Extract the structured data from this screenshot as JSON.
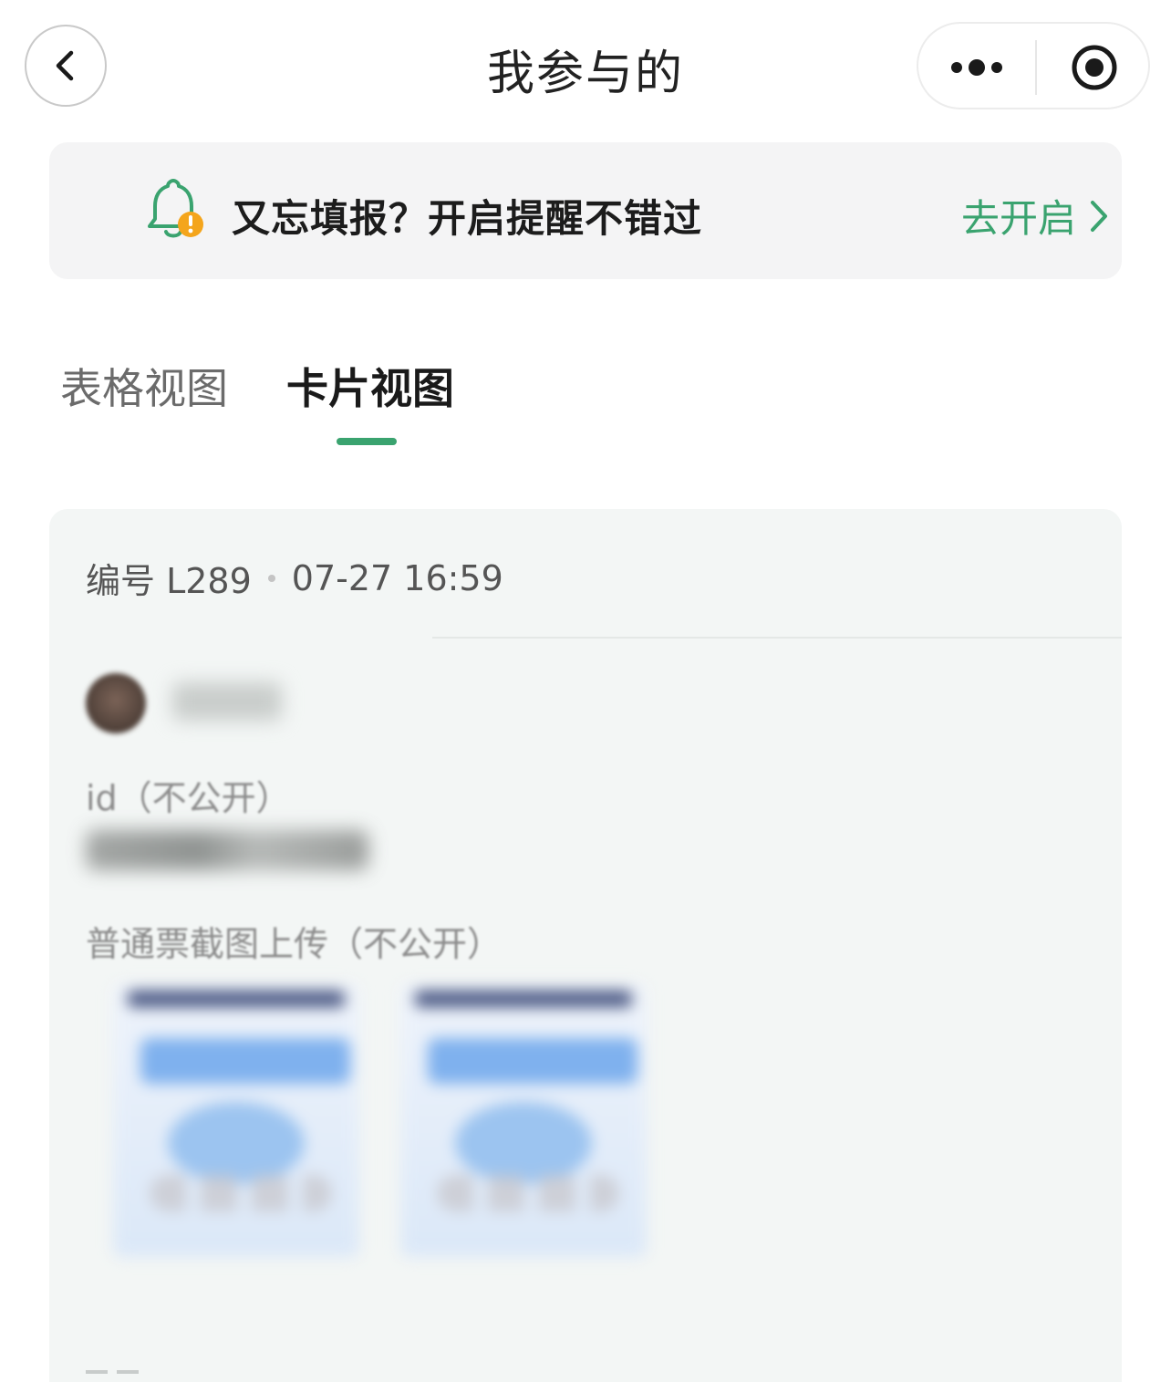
{
  "header": {
    "title": "我参与的",
    "back_icon": "chevron-left-icon",
    "more_icon": "more-dots-icon",
    "target_icon": "record-target-icon"
  },
  "reminder": {
    "icon": "bell-warning-icon",
    "text": "又忘填报？开启提醒不错过",
    "action_label": "去开启",
    "action_icon": "chevron-right-icon",
    "accent_color": "#3aa36f",
    "warning_color": "#f4a51c"
  },
  "tabs": [
    {
      "label": "表格视图",
      "active": false
    },
    {
      "label": "卡片视图",
      "active": true
    }
  ],
  "card": {
    "number": "编号 L289",
    "time": "07-27 16:59",
    "fields": [
      {
        "label": "id（不公开）"
      },
      {
        "label": "普通票截图上传（不公开）"
      }
    ]
  }
}
